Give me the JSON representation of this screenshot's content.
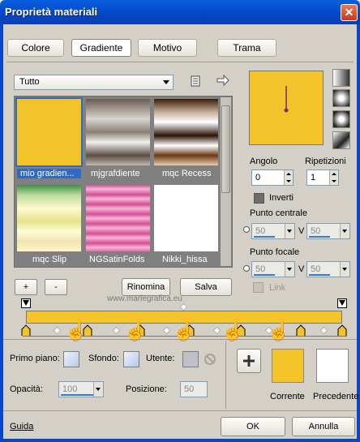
{
  "window": {
    "title": "Proprietà materiali",
    "close_icon": "close-icon"
  },
  "tabs": [
    {
      "label": "Colore"
    },
    {
      "label": "Gradiente",
      "active": true
    },
    {
      "label": "Motivo"
    },
    {
      "label": "Trama"
    }
  ],
  "category": {
    "value": "Tutto"
  },
  "gallery": {
    "items": [
      {
        "label": "mio gradien...",
        "selected": true
      },
      {
        "label": "mjgrafdiente"
      },
      {
        "label": "mqc Recess"
      },
      {
        "label": "mqc Slip"
      },
      {
        "label": "NGSatinFolds"
      },
      {
        "label": "Nikki_hissa"
      }
    ]
  },
  "buttons": {
    "add": "+",
    "remove": "-",
    "rename": "Rinomina",
    "save": "Salva",
    "ok": "OK",
    "cancel": "Annulla",
    "help": "Guida"
  },
  "angle": {
    "label": "Angolo",
    "value": "0"
  },
  "repeats": {
    "label": "Ripetizioni",
    "value": "1"
  },
  "invert": {
    "label": "Inverti"
  },
  "center": {
    "label": "Punto centrale",
    "h": "50",
    "v_label": "V",
    "v": "50"
  },
  "focal": {
    "label": "Punto focale",
    "h": "50",
    "v_label": "V",
    "v": "50"
  },
  "link": {
    "label": "Link"
  },
  "bottom": {
    "foreground_label": "Primo piano:",
    "background_label": "Sfondo:",
    "user_label": "Utente:",
    "opacity_label": "Opacità:",
    "opacity_value": "100",
    "position_label": "Posizione:",
    "position_value": "50",
    "current_label": "Corrente",
    "previous_label": "Precedente"
  },
  "watermark": "www.marlegrafica.eu",
  "colors": {
    "gradient": "#f2c42a",
    "selection": "#316ac5"
  }
}
